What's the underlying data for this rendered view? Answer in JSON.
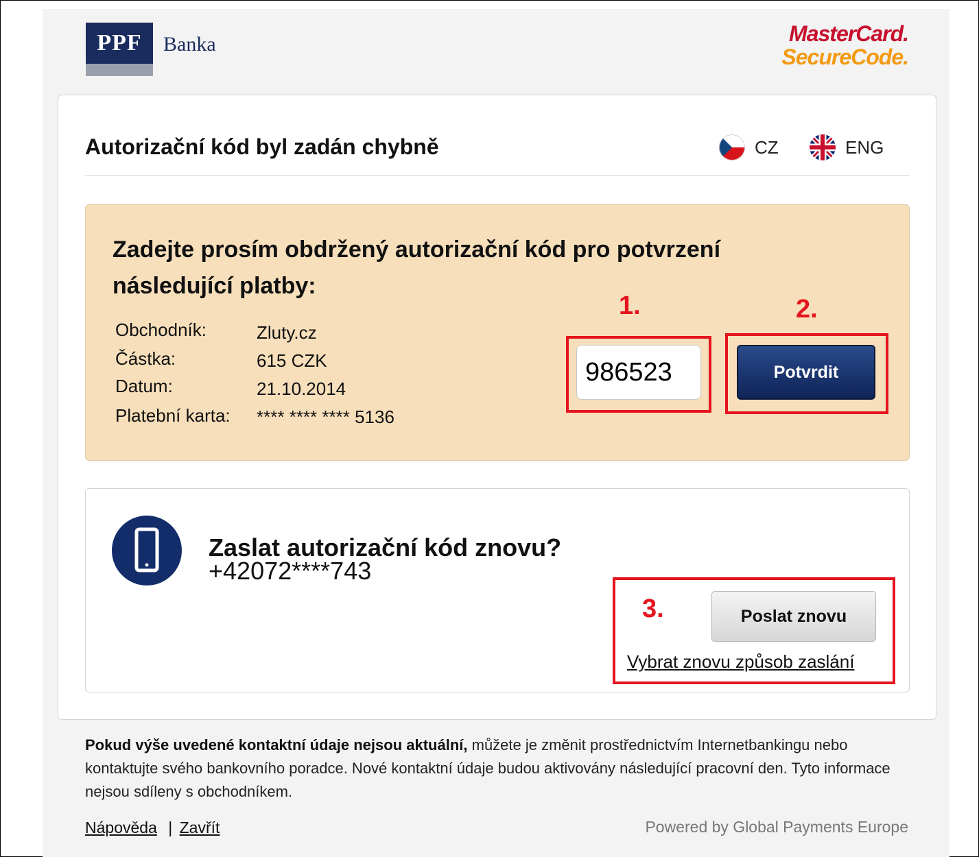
{
  "header": {
    "bank_logo_box": "PPF",
    "bank_logo_word": "Banka",
    "mc_line1": "MasterCard.",
    "mc_line2": "SecureCode."
  },
  "card": {
    "heading": "Autorizační kód byl zadán chybně",
    "languages": [
      {
        "code": "CZ",
        "icon": "czech-flag-icon"
      },
      {
        "code": "ENG",
        "icon": "uk-flag-icon"
      }
    ]
  },
  "payment": {
    "title": "Zadejte prosím obdržený autorizační kód pro potvrzení následující platby:",
    "labels": [
      "Obchodník:",
      "Částka:",
      "Datum:",
      "Platební karta:"
    ],
    "values": [
      "Zluty.cz",
      "615 CZK",
      "21.10.2014",
      "**** **** **** 5136"
    ],
    "code_value": "986523",
    "confirm_label": "Potvrdit"
  },
  "annotations": {
    "step1": "1.",
    "step2": "2.",
    "step3": "3.",
    "color": "#e4141e"
  },
  "resend": {
    "icon": "mobile-phone-icon",
    "title": "Zaslat autorizační kód znovu?",
    "phone": "+42072****743",
    "button_label": "Poslat znovu",
    "link_label": "Vybrat znovu způsob zaslání"
  },
  "footer": {
    "bold_text": "Pokud výše uvedené kontaktní údaje nejsou aktuální,",
    "rest_text": " můžete je změnit prostřednictvím Internetbankingu nebo kontaktujte svého bankovního poradce. Nové kontaktní údaje budou aktivovány následující pracovní den. Tyto informace nejsou sdíleny s obchodníkem.",
    "help_link": "Nápověda",
    "separator": "|",
    "close_link": "Zavřít",
    "powered_by": "Powered by Global Payments Europe"
  },
  "colors": {
    "brand_navy": "#1a2b5e",
    "panel_peach": "#f7dfbb",
    "mc_red": "#c8102e",
    "mc_orange": "#f39a12"
  }
}
